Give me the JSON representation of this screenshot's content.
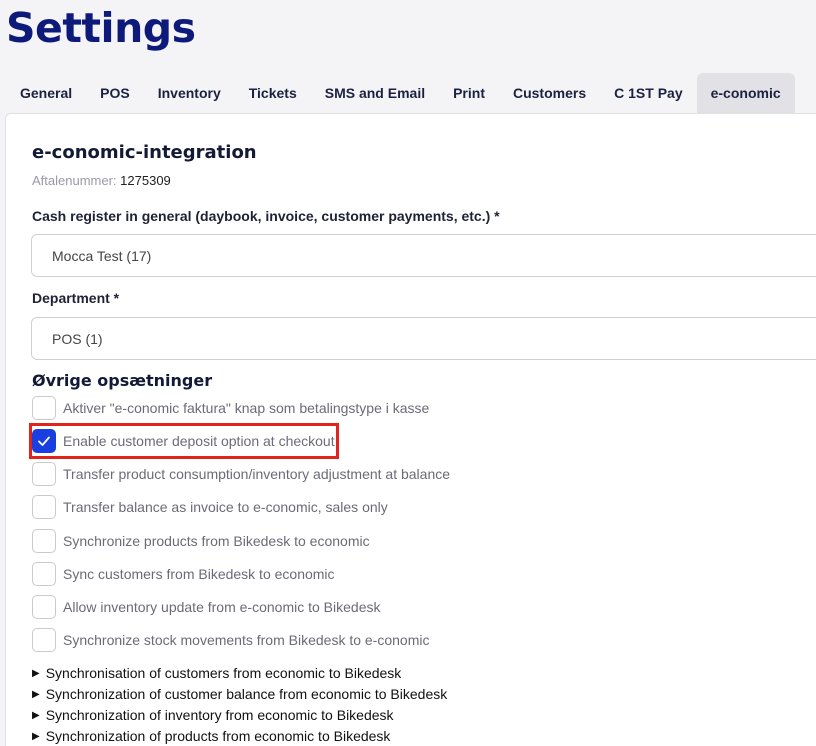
{
  "page": {
    "title": "Settings"
  },
  "tabs": [
    {
      "label": "General"
    },
    {
      "label": "POS"
    },
    {
      "label": "Inventory"
    },
    {
      "label": "Tickets"
    },
    {
      "label": "SMS and Email"
    },
    {
      "label": "Print"
    },
    {
      "label": "Customers"
    },
    {
      "label": "C 1ST Pay"
    },
    {
      "label": "e-conomic",
      "active": true
    }
  ],
  "integration": {
    "title": "e-conomic-integration",
    "agreement_label": "Aftalenummer:",
    "agreement_value": "1275309"
  },
  "fields": {
    "cash_register": {
      "label": "Cash register in general (daybook, invoice, customer payments, etc.) *",
      "value": "Mocca Test (17)"
    },
    "department": {
      "label": "Department *",
      "value": "POS (1)"
    }
  },
  "other_settings": {
    "title": "Øvrige opsætninger",
    "checkboxes": [
      {
        "label": "Aktiver \"e-conomic faktura\" knap som betalingstype i kasse",
        "checked": false
      },
      {
        "label": "Enable customer deposit option at checkout",
        "checked": true
      },
      {
        "label": "Transfer product consumption/inventory adjustment at balance",
        "checked": false
      },
      {
        "label": "Transfer balance as invoice to e-conomic, sales only",
        "checked": false
      },
      {
        "label": "Synchronize products from Bikedesk to economic",
        "checked": false
      },
      {
        "label": "Sync customers from Bikedesk to economic",
        "checked": false
      },
      {
        "label": "Allow inventory update from e-conomic to Bikedesk",
        "checked": false
      },
      {
        "label": "Synchronize stock movements from Bikedesk to e-conomic",
        "checked": false
      }
    ]
  },
  "expandables": [
    {
      "label": "Synchronisation of customers from economic to Bikedesk"
    },
    {
      "label": "Synchronization of customer balance from economic to Bikedesk"
    },
    {
      "label": "Synchronization of inventory from economic to Bikedesk"
    },
    {
      "label": "Synchronization of products from economic to Bikedesk"
    }
  ],
  "colors": {
    "accent": "#1a3fe0",
    "title": "#0d1a7a",
    "highlight": "#e0231d"
  }
}
